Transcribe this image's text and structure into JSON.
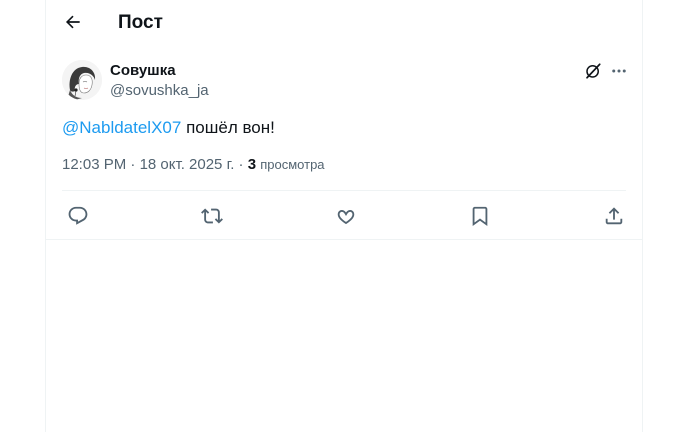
{
  "header": {
    "title": "Пост",
    "back_icon": "arrow-left-icon"
  },
  "tweet": {
    "author": {
      "name": "Совушка",
      "handle": "@sovushka_ja",
      "avatar": "sketch-portrait-avatar"
    },
    "text": {
      "mention": "@NabldatelX07",
      "body": " пошёл вон!"
    },
    "meta": {
      "time": "12:03 PM",
      "sep1": " · ",
      "date": "18 окт. 2025 г.",
      "sep2": " · ",
      "views_count": "3",
      "views_label": "просмотра"
    },
    "top_icons": [
      "grok-icon",
      "more-icon"
    ],
    "actions": [
      "reply-icon",
      "retweet-icon",
      "like-icon",
      "bookmark-icon",
      "share-icon"
    ]
  },
  "colors": {
    "text": "#0f1419",
    "secondary": "#536471",
    "accent": "#1d9bf0",
    "border": "#eff3f4"
  }
}
